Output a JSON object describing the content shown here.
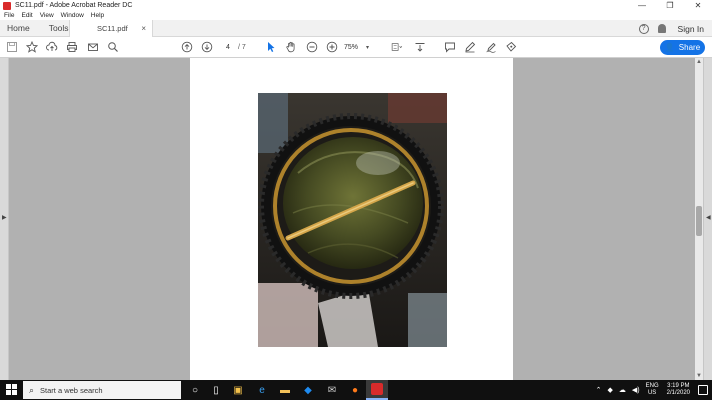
{
  "window": {
    "title": "SC11.pdf - Adobe Acrobat Reader DC",
    "minimize": "—",
    "restore": "❐",
    "close": "✕"
  },
  "menu": [
    "File",
    "Edit",
    "View",
    "Window",
    "Help"
  ],
  "tabs": {
    "home": "Home",
    "tools": "Tools",
    "document": "SC11.pdf",
    "close": "×"
  },
  "header_right": {
    "help": "?",
    "signin": "Sign In"
  },
  "toolbar": {
    "current_page": "4",
    "page_total": "/ 7",
    "zoom": "75%",
    "zoom_caret": "▾",
    "share_label": "Share"
  },
  "taskbar": {
    "search_placeholder": "Start a web search",
    "language": "ENG",
    "region": "US",
    "time": "3:19 PM",
    "date": "2/1/2020"
  },
  "colors": {
    "share_button": "#1473e6",
    "doc_background": "#b1b1b1",
    "taskbar": "#101010"
  }
}
